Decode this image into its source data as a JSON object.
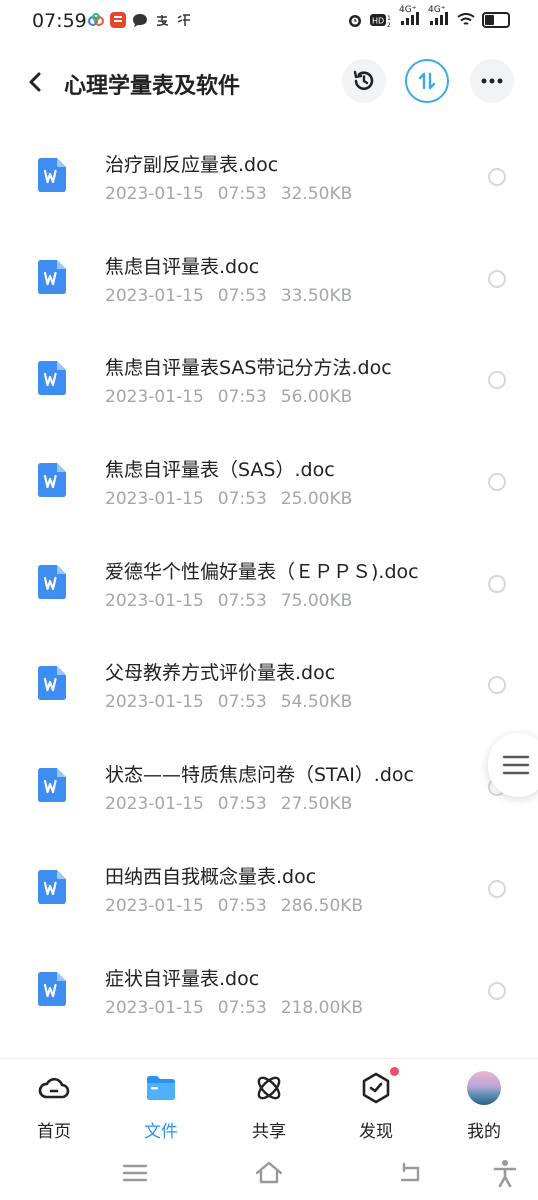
{
  "status_bar": {
    "time": "07:59",
    "app_icons": [
      "baidu-netdisk",
      "toutiao",
      "message",
      "alipay",
      "taobao"
    ],
    "signal_1": "4G⁺",
    "signal_2": "4G⁺",
    "hd": "HD"
  },
  "header": {
    "title": "心理学量表及软件",
    "icons": [
      "history-icon",
      "sort-icon",
      "more-icon"
    ]
  },
  "files": [
    {
      "name": "治疗副反应量表.doc",
      "date": "2023-01-15",
      "time": "07:53",
      "size": "32.50KB"
    },
    {
      "name": "焦虑自评量表.doc",
      "date": "2023-01-15",
      "time": "07:53",
      "size": "33.50KB"
    },
    {
      "name": "焦虑自评量表SAS带记分方法.doc",
      "date": "2023-01-15",
      "time": "07:53",
      "size": "56.00KB"
    },
    {
      "name": "焦虑自评量表（SAS）.doc",
      "date": "2023-01-15",
      "time": "07:53",
      "size": "25.00KB"
    },
    {
      "name": "爱德华个性偏好量表（ＥＰＰＳ).doc",
      "date": "2023-01-15",
      "time": "07:53",
      "size": "75.00KB"
    },
    {
      "name": "父母教养方式评价量表.doc",
      "date": "2023-01-15",
      "time": "07:53",
      "size": "54.50KB"
    },
    {
      "name": "状态——特质焦虑问卷（STAI）.doc",
      "date": "2023-01-15",
      "time": "07:53",
      "size": "27.50KB"
    },
    {
      "name": "田纳西自我概念量表.doc",
      "date": "2023-01-15",
      "time": "07:53",
      "size": "286.50KB"
    },
    {
      "name": "症状自评量表.doc",
      "date": "2023-01-15",
      "time": "07:53",
      "size": "218.00KB"
    }
  ],
  "tabs": [
    {
      "label": "首页",
      "icon": "home-cloud-icon",
      "active": false
    },
    {
      "label": "文件",
      "icon": "folder-icon",
      "active": true
    },
    {
      "label": "共享",
      "icon": "share-atom-icon",
      "active": false
    },
    {
      "label": "发现",
      "icon": "discover-icon",
      "active": false,
      "badge": true
    },
    {
      "label": "我的",
      "icon": "avatar",
      "active": false
    }
  ],
  "colors": {
    "accent": "#2a94f4",
    "word_icon": "#3d8ef0",
    "badge": "#f24e60",
    "meta_text": "#a3a6ad"
  }
}
